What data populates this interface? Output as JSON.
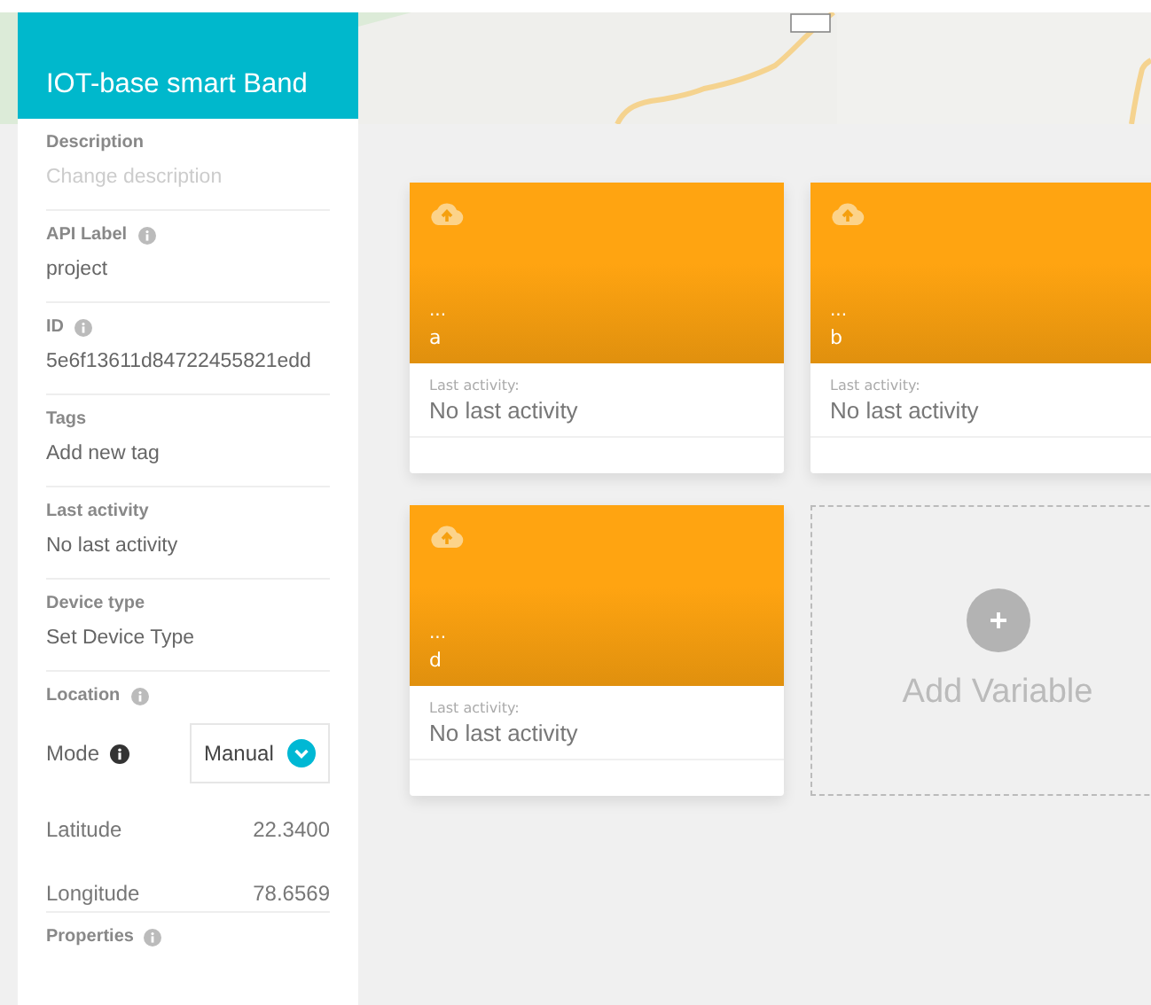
{
  "device": {
    "title": "IOT-base smart Band"
  },
  "sidebar": {
    "sections": [
      {
        "kind": "field",
        "label": "Description",
        "info": false,
        "placeholder": "Change description"
      },
      {
        "kind": "field",
        "label": "API Label",
        "info": true,
        "value": "project"
      },
      {
        "kind": "field",
        "label": "ID",
        "info": true,
        "value": "5e6f13611d84722455821edd"
      },
      {
        "kind": "field",
        "label": "Tags",
        "info": false,
        "value": "Add new tag"
      },
      {
        "kind": "field",
        "label": "Last activity",
        "info": false,
        "value": "No last activity"
      },
      {
        "kind": "field",
        "label": "Device type",
        "info": false,
        "value": "Set Device Type"
      },
      {
        "kind": "location",
        "label": "Location",
        "info": true,
        "mode_label": "Mode",
        "mode_value": "Manual",
        "coords": [
          {
            "label": "Latitude",
            "value": "22.3400"
          },
          {
            "label": "Longitude",
            "value": "78.6569"
          }
        ]
      },
      {
        "kind": "heading",
        "label": "Properties",
        "info": true
      }
    ]
  },
  "variables": [
    {
      "kind": "variable",
      "dots": "...",
      "name": "a",
      "activity_label": "Last activity:",
      "activity": "No last activity"
    },
    {
      "kind": "variable",
      "dots": "...",
      "name": "b",
      "activity_label": "Last activity:",
      "activity": "No last activity"
    },
    {
      "kind": "variable",
      "dots": "...",
      "name": "d",
      "activity_label": "Last activity:",
      "activity": "No last activity"
    },
    {
      "kind": "add",
      "label": "Add Variable"
    }
  ]
}
